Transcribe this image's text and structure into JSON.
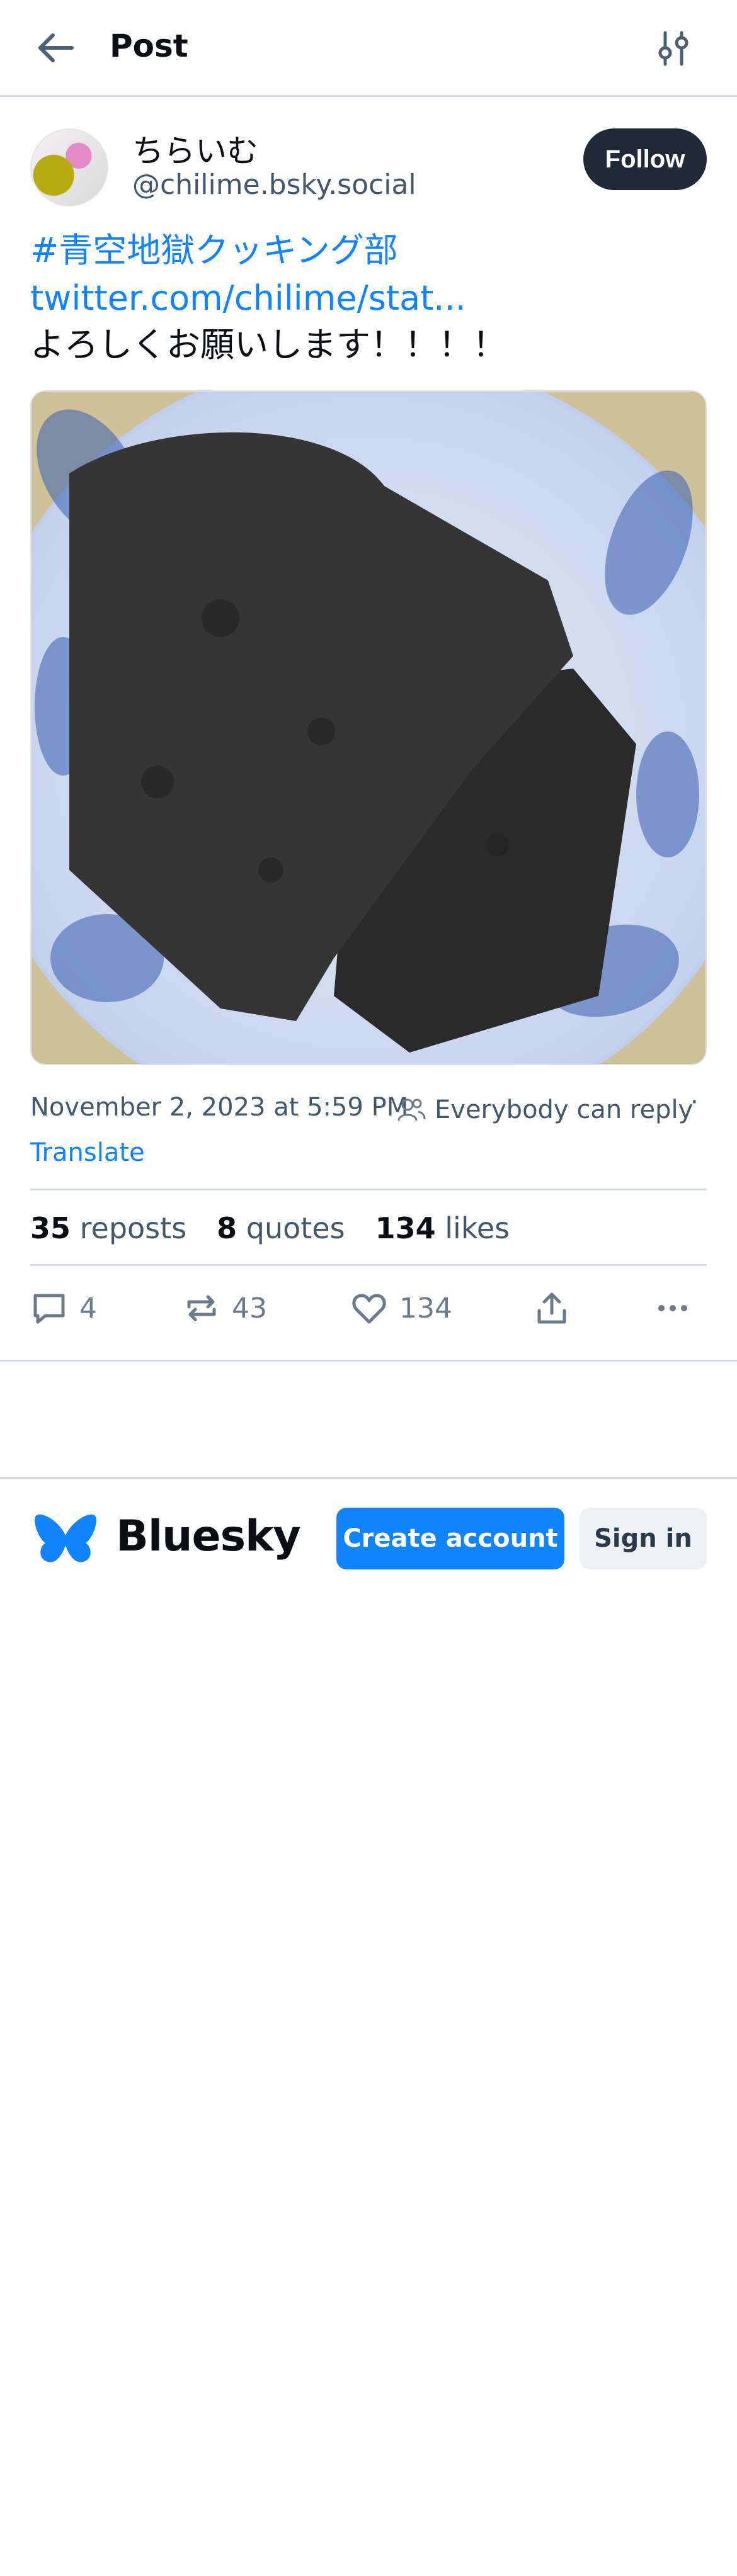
{
  "header": {
    "title": "Post"
  },
  "post": {
    "author_name": "ちらいむ",
    "author_handle": "@chilime.bsky.social",
    "follow_label": "Follow",
    "lines": [
      "#青空地獄クッキング部",
      "twitter.com/chilime/stat...",
      "よろしくお願いします！！！！"
    ],
    "timestamp": "November 2, 2023 at 5:59 PM",
    "reply_setting": "Everybody can reply",
    "separator": "·",
    "translate_label": "Translate",
    "stats": {
      "reposts_count": "35",
      "reposts_label": "reposts",
      "quotes_count": "8",
      "quotes_label": "quotes",
      "likes_count": "134",
      "likes_label": "likes"
    },
    "actions": {
      "reply_count": "4",
      "repost_count": "43",
      "like_count": "134"
    }
  },
  "footer": {
    "brand": "Bluesky",
    "create_account_label": "Create account",
    "sign_in_label": "Sign in"
  },
  "colors": {
    "accent": "#1083fe",
    "text": "#0b0f14",
    "muted": "#42576c",
    "follow_bg": "#1f2a36",
    "border": "#d4dbe2"
  },
  "icons": [
    "back-arrow-icon",
    "filter-icon",
    "people-icon",
    "reply-icon",
    "repost-icon",
    "like-icon",
    "share-icon",
    "more-icon",
    "butterfly-icon"
  ]
}
